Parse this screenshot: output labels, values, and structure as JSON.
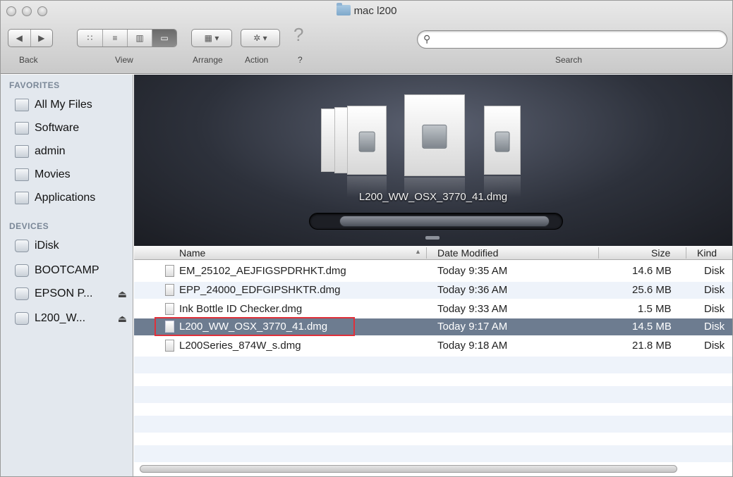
{
  "window": {
    "title": "mac l200"
  },
  "toolbar": {
    "back_label": "Back",
    "view_label": "View",
    "arrange_label": "Arrange",
    "action_label": "Action",
    "help_glyph": "?",
    "help_label": "?",
    "search_label": "Search",
    "search_value": "",
    "icons": {
      "back": "◀",
      "forward": "▶",
      "view_icon": "∷",
      "view_list": "≡",
      "view_column": "▥",
      "view_coverflow": "▭",
      "arrange": "▦ ▾",
      "action": "✲ ▾",
      "search": "🔍"
    }
  },
  "sidebar": {
    "favorites_heading": "FAVORITES",
    "devices_heading": "DEVICES",
    "favorites": [
      {
        "label": "All My Files"
      },
      {
        "label": "Software"
      },
      {
        "label": "admin"
      },
      {
        "label": "Movies"
      },
      {
        "label": "Applications"
      }
    ],
    "devices": [
      {
        "label": "iDisk",
        "eject": ""
      },
      {
        "label": "BOOTCAMP",
        "eject": ""
      },
      {
        "label": "EPSON P...",
        "eject": "⏏"
      },
      {
        "label": "L200_W...",
        "eject": "⏏"
      }
    ]
  },
  "coverflow": {
    "caption": "L200_WW_OSX_3770_41.dmg"
  },
  "list": {
    "columns": {
      "name": "Name",
      "date": "Date Modified",
      "size": "Size",
      "kind": "Kind"
    },
    "rows": [
      {
        "name": "EM_25102_AEJFIGSPDRHKT.dmg",
        "date": "Today 9:35 AM",
        "size": "14.6 MB",
        "kind": "Disk"
      },
      {
        "name": "EPP_24000_EDFGIPSHKTR.dmg",
        "date": "Today 9:36 AM",
        "size": "25.6 MB",
        "kind": "Disk"
      },
      {
        "name": "Ink Bottle ID Checker.dmg",
        "date": "Today 9:33 AM",
        "size": "1.5 MB",
        "kind": "Disk"
      },
      {
        "name": "L200_WW_OSX_3770_41.dmg",
        "date": "Today 9:17 AM",
        "size": "14.5 MB",
        "kind": "Disk"
      },
      {
        "name": "L200Series_874W_s.dmg",
        "date": "Today 9:18 AM",
        "size": "21.8 MB",
        "kind": "Disk"
      }
    ],
    "selected_row": 3
  },
  "colors": {
    "selection": "#6d7c90",
    "highlight_box": "#e0303a",
    "sidebar_bg": "#e3e8ee"
  }
}
